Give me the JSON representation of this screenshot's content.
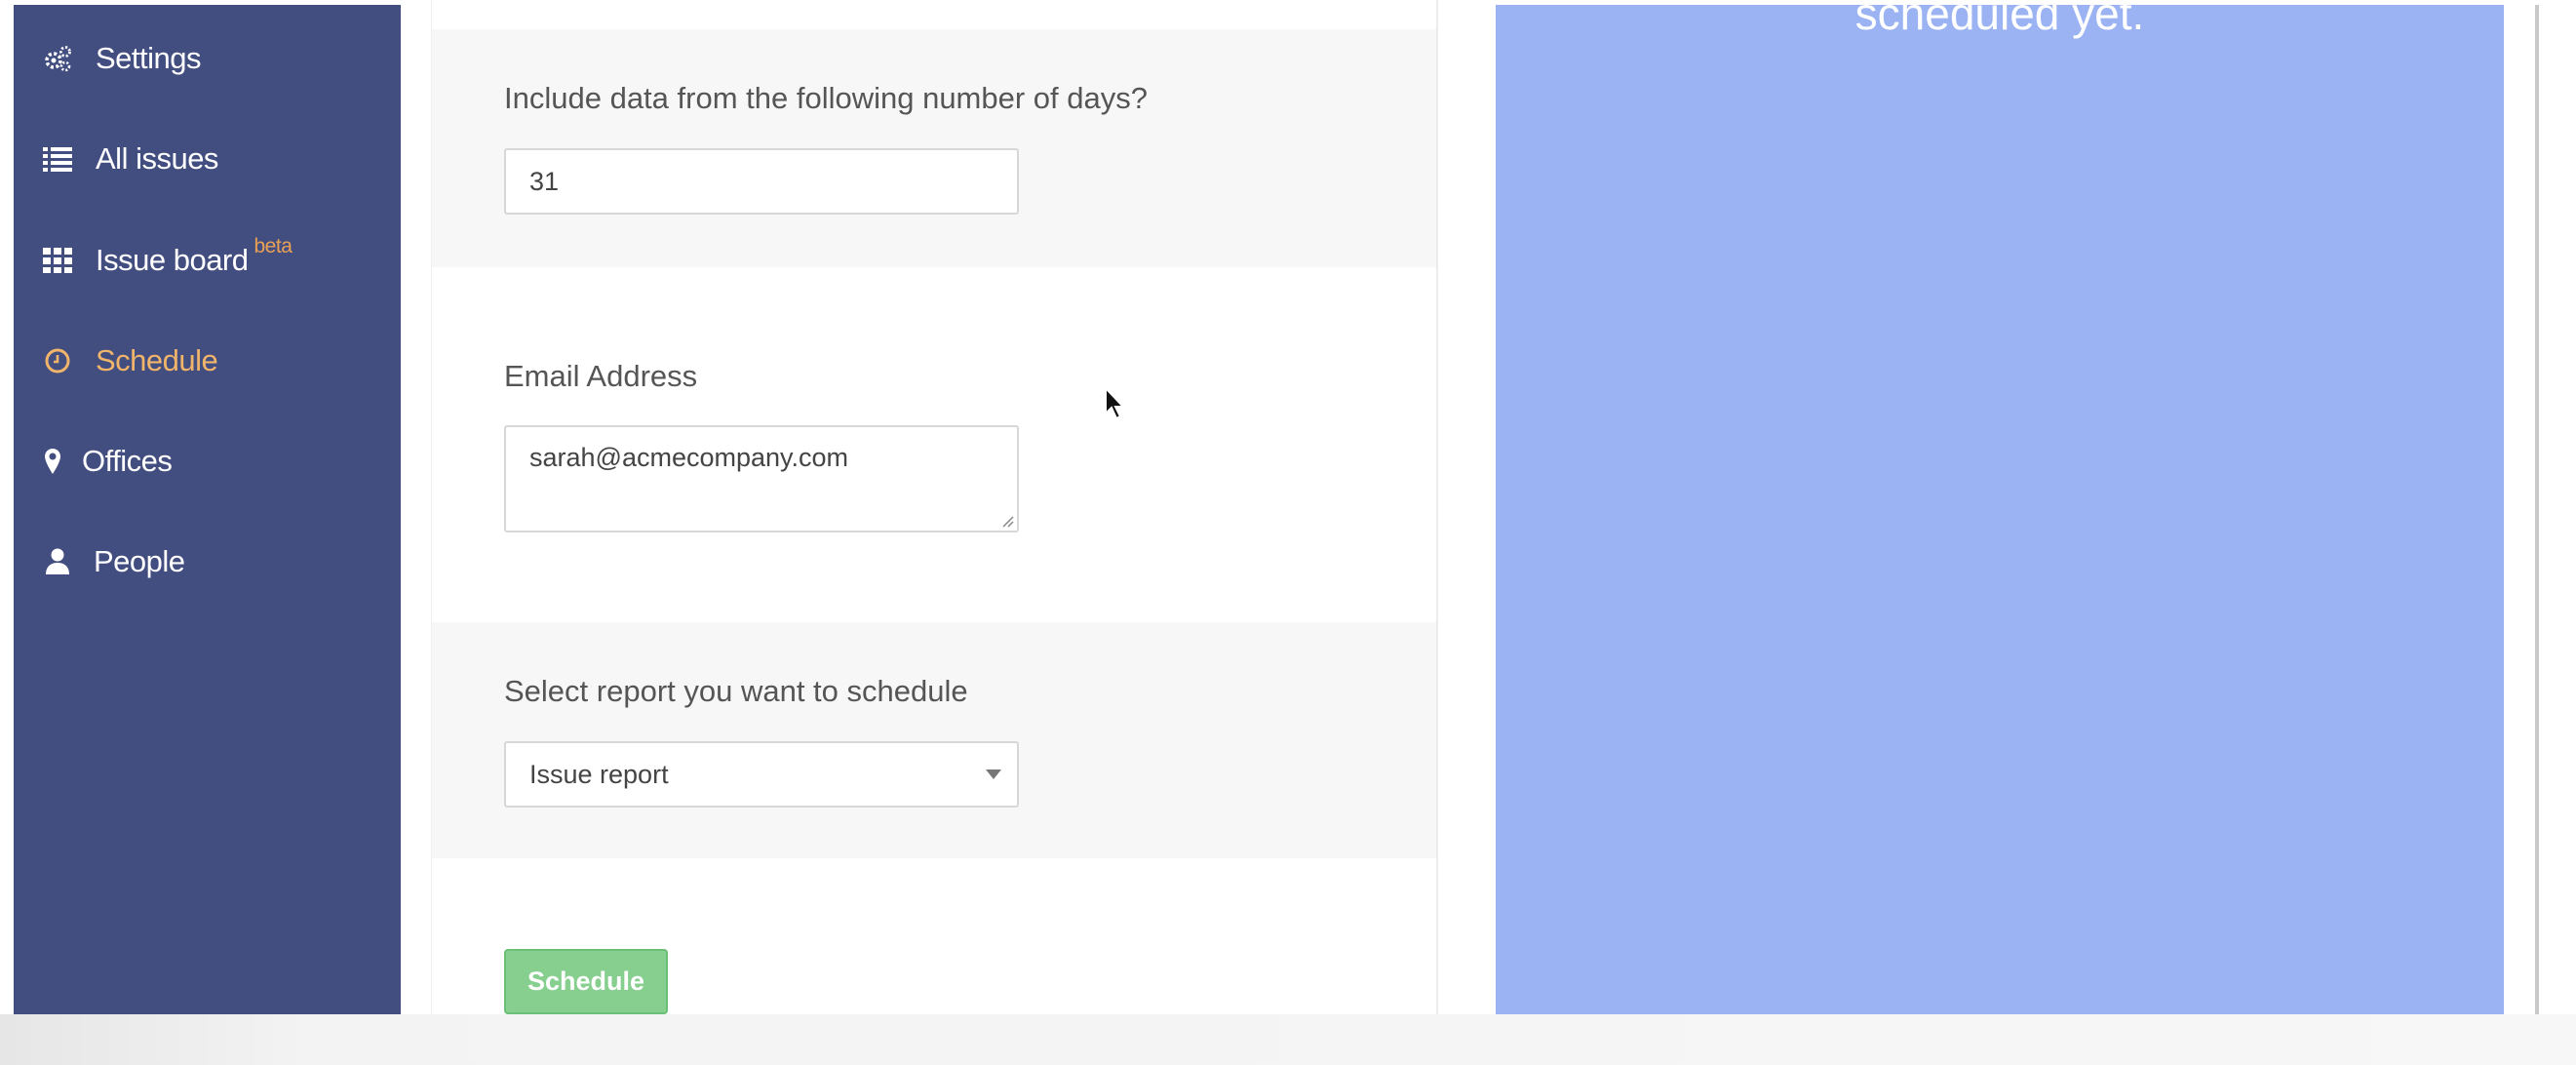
{
  "sidebar": {
    "items": [
      {
        "label": "Settings",
        "icon": "gears-icon"
      },
      {
        "label": "All issues",
        "icon": "list-icon"
      },
      {
        "label": "Issue board",
        "icon": "grid-icon",
        "badge": "beta"
      },
      {
        "label": "Schedule",
        "icon": "clock-icon",
        "active": true
      },
      {
        "label": "Offices",
        "icon": "map-pin-icon"
      },
      {
        "label": "People",
        "icon": "person-icon"
      }
    ]
  },
  "form": {
    "days": {
      "label": "Include data from the following number of days?",
      "value": "31"
    },
    "email": {
      "label": "Email Address",
      "value": "sarah@acmecompany.com"
    },
    "report": {
      "label": "Select report you want to schedule",
      "selected": "Issue report"
    },
    "submit_label": "Schedule"
  },
  "panel": {
    "empty_text": "scheduled yet."
  },
  "colors": {
    "sidebar_bg": "#434e80",
    "active_nav": "#f0b46a",
    "beta_badge": "#e8a055",
    "panel_bg": "#9bb3f3",
    "button_bg": "#86cf8f"
  }
}
